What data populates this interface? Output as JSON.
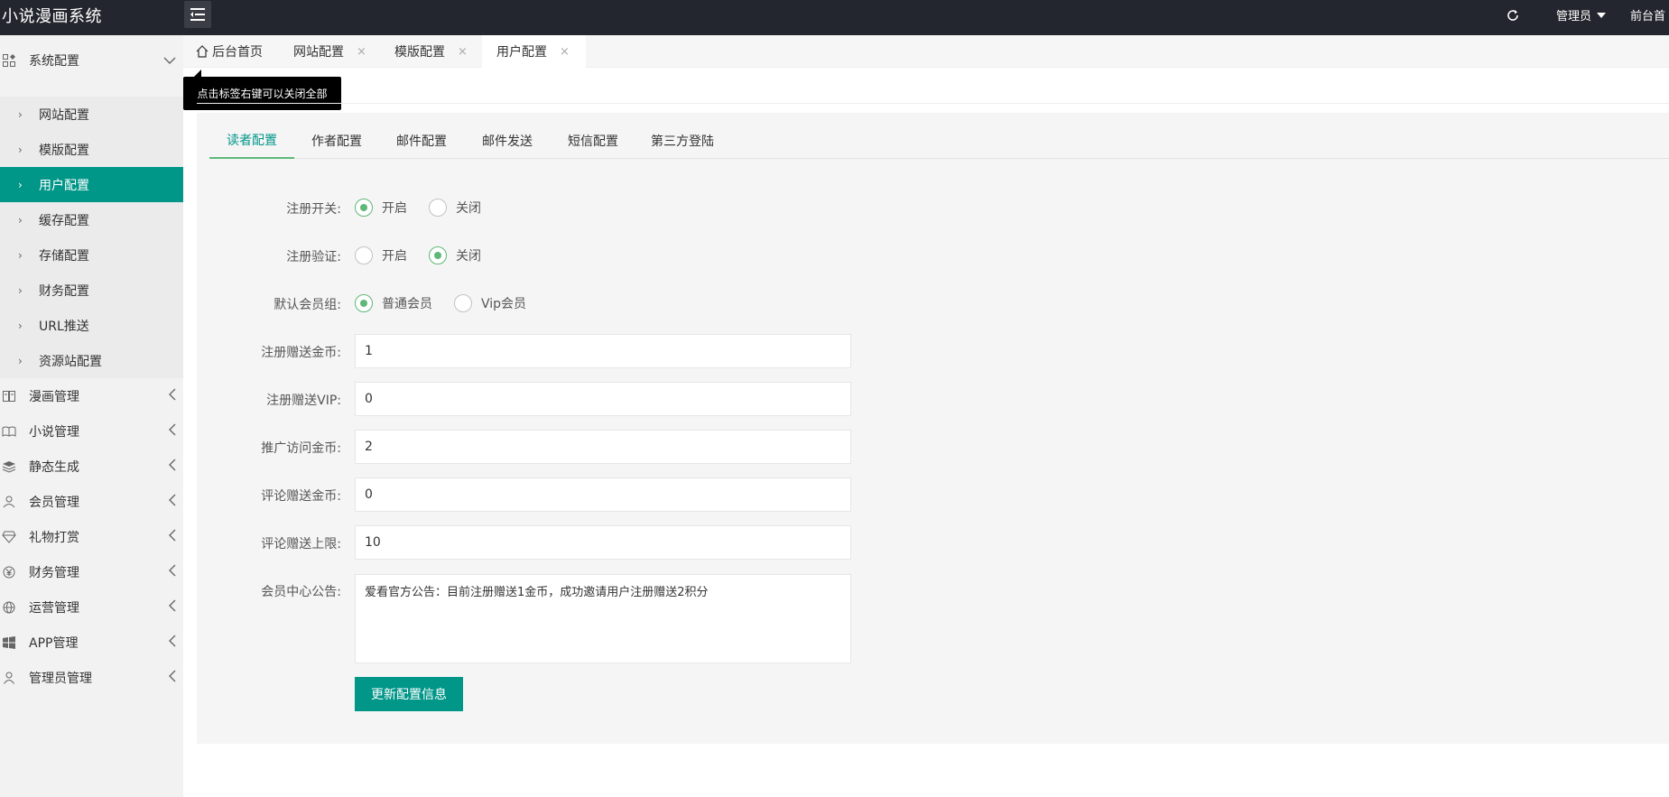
{
  "app": {
    "title": "小说漫画系统"
  },
  "header": {
    "admin_label": "管理员",
    "front_label": "前台首"
  },
  "sidebar": {
    "groups": [
      {
        "label": "系统配置",
        "icon": "grid-icon",
        "expanded": true
      },
      {
        "label": "漫画管理",
        "icon": "comic-icon"
      },
      {
        "label": "小说管理",
        "icon": "book-icon"
      },
      {
        "label": "静态生成",
        "icon": "layers-icon"
      },
      {
        "label": "会员管理",
        "icon": "user-icon"
      },
      {
        "label": "礼物打赏",
        "icon": "diamond-icon"
      },
      {
        "label": "财务管理",
        "icon": "yen-icon"
      },
      {
        "label": "运营管理",
        "icon": "globe-icon"
      },
      {
        "label": "APP管理",
        "icon": "windows-icon"
      },
      {
        "label": "管理员管理",
        "icon": "person-icon"
      }
    ],
    "sub_items": [
      {
        "label": "网站配置"
      },
      {
        "label": "模版配置"
      },
      {
        "label": "用户配置",
        "active": true
      },
      {
        "label": "缓存配置"
      },
      {
        "label": "存储配置"
      },
      {
        "label": "财务配置"
      },
      {
        "label": "URL推送"
      },
      {
        "label": "资源站配置"
      }
    ]
  },
  "tabs": [
    {
      "label": "后台首页",
      "icon": "home-icon"
    },
    {
      "label": "网站配置",
      "close": "×"
    },
    {
      "label": "模版配置",
      "close": "×"
    },
    {
      "label": "用户配置",
      "close": "×",
      "active": true
    }
  ],
  "tooltip": {
    "text": "点击标签右键可以关闭全部"
  },
  "subtabs": [
    {
      "label": "读者配置",
      "active": true
    },
    {
      "label": "作者配置"
    },
    {
      "label": "邮件配置"
    },
    {
      "label": "邮件发送"
    },
    {
      "label": "短信配置"
    },
    {
      "label": "第三方登陆"
    }
  ],
  "form": {
    "register_switch": {
      "label": "注册开关:",
      "options": [
        "开启",
        "关闭"
      ],
      "selected": "开启"
    },
    "register_verify": {
      "label": "注册验证:",
      "options": [
        "开启",
        "关闭"
      ],
      "selected": "关闭"
    },
    "default_group": {
      "label": "默认会员组:",
      "options": [
        "普通会员",
        "Vip会员"
      ],
      "selected": "普通会员"
    },
    "reg_gold": {
      "label": "注册赠送金币:",
      "value": "1"
    },
    "reg_vip": {
      "label": "注册赠送VIP:",
      "value": "0"
    },
    "promo_gold": {
      "label": "推广访问金币:",
      "value": "2"
    },
    "comment_gold": {
      "label": "评论赠送金币:",
      "value": "0"
    },
    "comment_limit": {
      "label": "评论赠送上限:",
      "value": "10"
    },
    "notice": {
      "label": "会员中心公告:",
      "value": "爱看官方公告：目前注册赠送1金币，成功邀请用户注册赠送2积分"
    },
    "submit_label": "更新配置信息"
  },
  "colors": {
    "accent": "#009688",
    "radio_on": "#5fb878",
    "topbar": "#23262e",
    "sidebar": "#f2f2f2"
  }
}
